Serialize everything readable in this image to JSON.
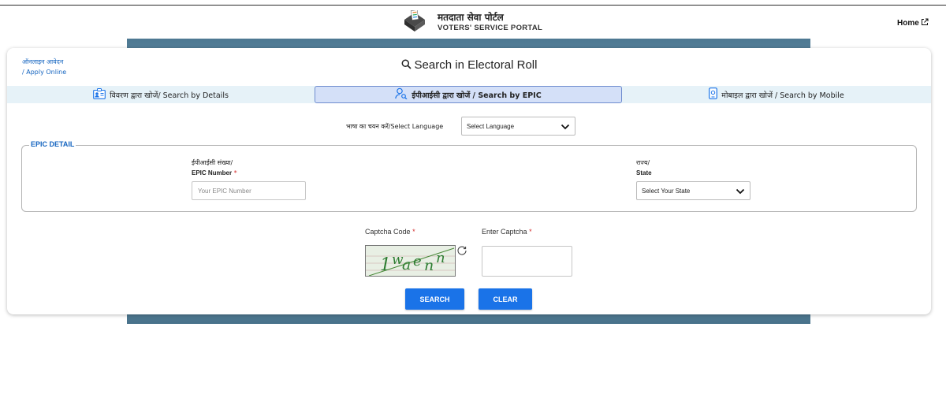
{
  "header": {
    "portal_name_hindi": "मतदाता सेवा पोर्टल",
    "portal_name_english": "VOTERS' SERVICE PORTAL",
    "home_label": "Home",
    "logo_icon": "ballot-box-icon",
    "external_icon": "external-link-icon"
  },
  "card": {
    "apply_online_hindi": "ऑनलाइन आवेदन",
    "apply_online_english": "/ Apply Online",
    "title": "Search in Electoral Roll",
    "title_icon": "search-icon"
  },
  "tabs": [
    {
      "label": "विवरण द्वारा खोजें/ Search by Details",
      "icon": "id-card-icon",
      "active": false
    },
    {
      "label": "ईपीआईसी द्वारा खोजें / Search by EPIC",
      "icon": "user-search-icon",
      "active": true
    },
    {
      "label": "मोबाइल द्वारा खोजें / Search by Mobile",
      "icon": "mobile-icon",
      "active": false
    }
  ],
  "language": {
    "label": "भाषा का चयन करें/Select Language",
    "selected": "Select Language"
  },
  "epic_detail": {
    "legend": "EPIC DETAIL",
    "epic_label_hindi": "ईपीआईसी संख्या/",
    "epic_label_english": "EPIC Number",
    "required_mark": "*",
    "epic_placeholder": "Your EPIC Number",
    "state_label_hindi": "राज्य/",
    "state_label_english": "State",
    "state_selected": "Select Your State"
  },
  "captcha": {
    "code_label": "Captcha Code",
    "enter_label": "Enter Captcha",
    "required_mark": "*",
    "captcha_text": "1wa e n n",
    "refresh_icon": "refresh-icon"
  },
  "buttons": {
    "search": "SEARCH",
    "clear": "CLEAR"
  },
  "colors": {
    "accent": "#1a73e8",
    "link": "#1565c0",
    "tab_bar": "#e6f2f8",
    "active_tab": "#d4e0f8",
    "required": "#d32f2f"
  }
}
